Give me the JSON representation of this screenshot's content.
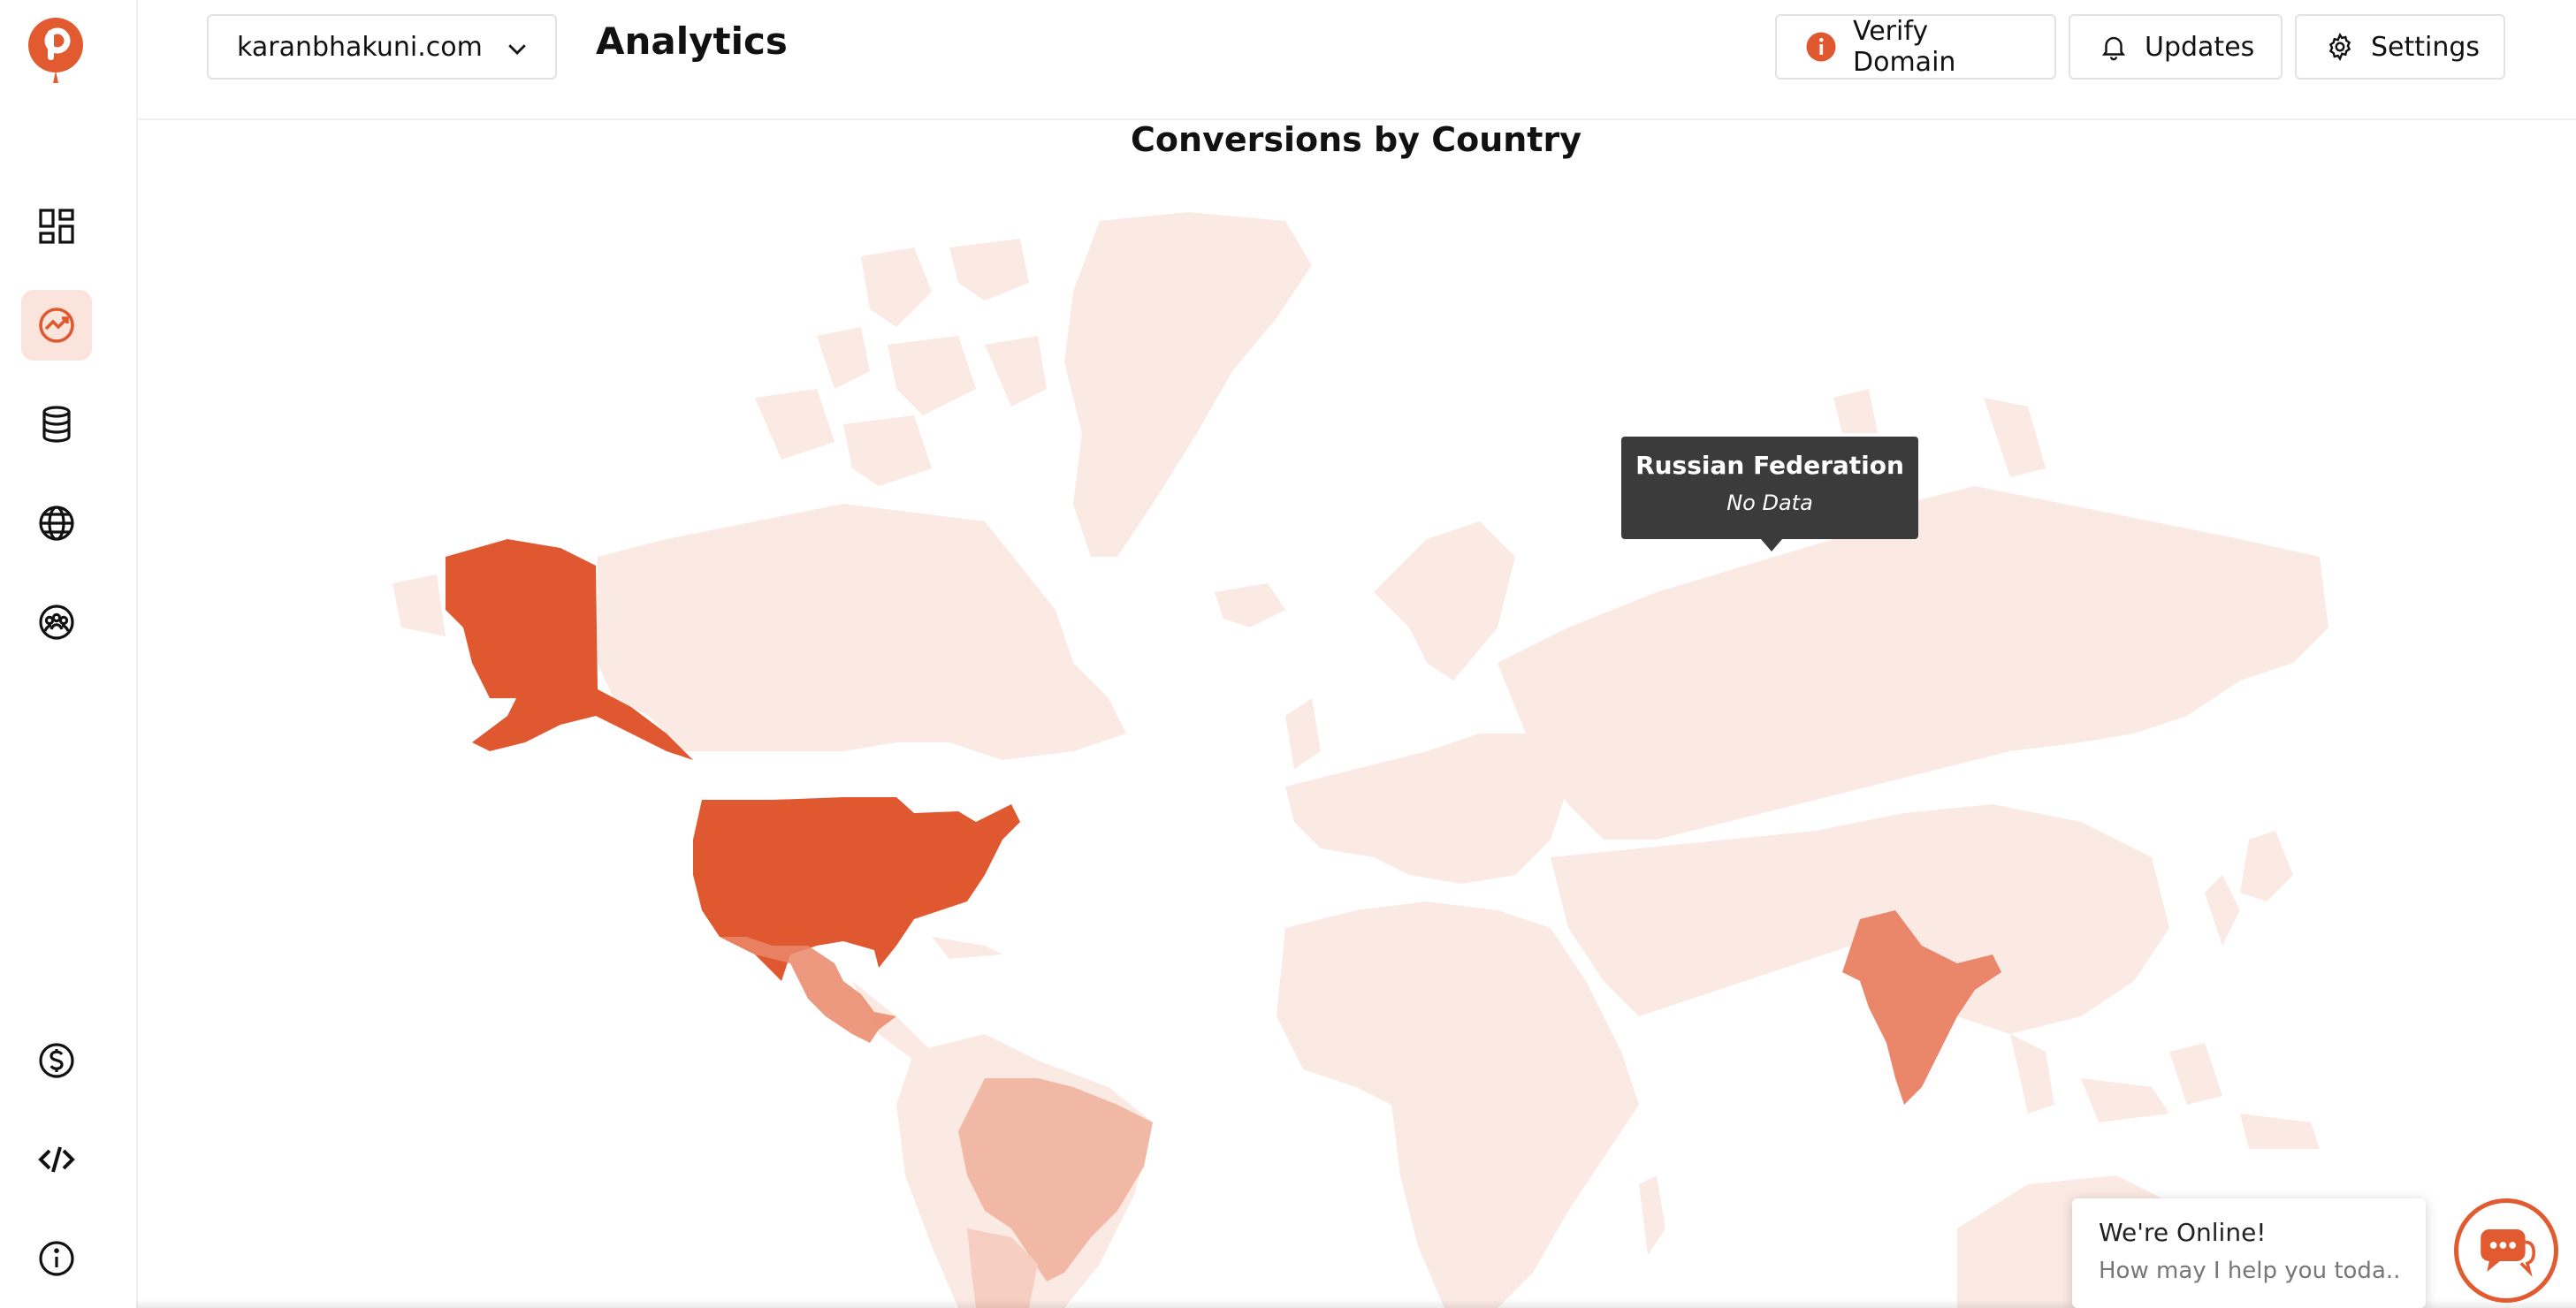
{
  "header": {
    "domain": "karanbhakuni.com",
    "title": "Analytics",
    "verify_label": "Verify Domain",
    "updates_label": "Updates",
    "settings_label": "Settings"
  },
  "map": {
    "title": "Conversions by Country",
    "tooltip_country": "Russian Federation",
    "tooltip_value": "No Data",
    "colors": {
      "high": "#e0582f",
      "medium": "#ea876a",
      "low": "#f1b8a5",
      "lower": "#f6cfc2",
      "none": "#fbe9e4"
    },
    "countries": [
      {
        "name": "United States",
        "level": "high"
      },
      {
        "name": "India",
        "level": "medium"
      },
      {
        "name": "Mexico",
        "level": "low"
      },
      {
        "name": "Brazil",
        "level": "low"
      },
      {
        "name": "Argentina",
        "level": "lower"
      },
      {
        "name": "Russian Federation",
        "level": "none"
      }
    ]
  },
  "chat": {
    "line1": "We're Online!",
    "line2": "How may I help you toda..."
  },
  "icons": [
    "dashboard-icon",
    "analytics-icon",
    "database-icon",
    "globe-icon",
    "community-icon",
    "dollar-icon",
    "code-icon",
    "info-icon",
    "bell-icon",
    "gear-icon",
    "chat-icon"
  ],
  "accent": "#e0582f"
}
